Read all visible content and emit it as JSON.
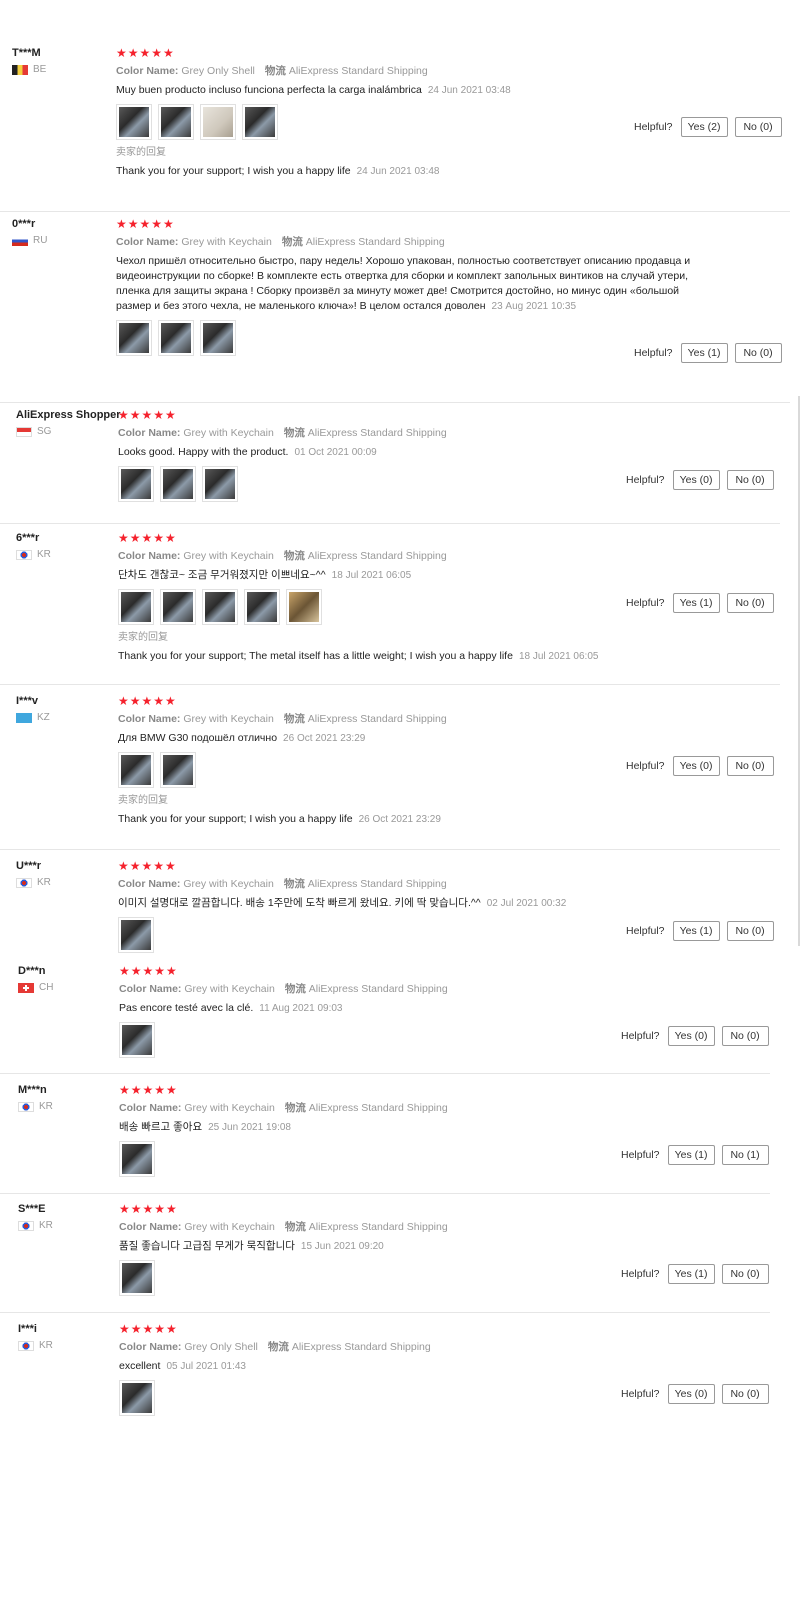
{
  "labels": {
    "color_name": "Color Name:",
    "logistics": "物流",
    "helpful": "Helpful?",
    "seller_reply": "卖家的回复"
  },
  "colors": {
    "star_red": "#f5222d",
    "meta_gray": "#999999",
    "button_border": "#999999"
  },
  "reviews": [
    {
      "user": "T***M",
      "country": "BE",
      "flag": "flag-belgium",
      "stars": "★★★★★",
      "color": "Grey Only Shell",
      "shipping": "AliExpress Standard Shipping",
      "text": "Muy buen producto incluso funciona perfecta la carga inalámbrica",
      "date": "24 Jun 2021 03:48",
      "photos": [
        "key-case-photo",
        "key-case-photo",
        "package-photo",
        "key-case-photo"
      ],
      "reply": "Thank you for your support; I wish you a happy life",
      "reply_date": "24 Jun 2021 03:48",
      "yes": "Yes (2)",
      "no": "No (0)"
    },
    {
      "user": "0***r",
      "country": "RU",
      "flag": "flag-russia",
      "stars": "★★★★★",
      "color": "Grey with Keychain",
      "shipping": "AliExpress Standard Shipping",
      "text": "Чехол пришёл относительно быстро, пару недель! Хорошо упакован, полностью соответствует описанию продавца и видеоинструкции по сборке! В комплекте есть отвертка для сборки и комплект запольных винтиков на случай утери, пленка для защиты экрана ! Сборку произвёл за минуту может две! Смотрится достойно, но минус один «большой размер и без этого чехла, не маленького ключа»! В целом остался доволен",
      "date": "23 Aug 2021 10:35",
      "photos": [
        "key-case-photo",
        "key-case-photo",
        "key-case-photo"
      ],
      "yes": "Yes (1)",
      "no": "No (0)"
    },
    {
      "user": "AliExpress Shopper",
      "country": "SG",
      "flag": "flag-singapore",
      "stars": "★★★★★",
      "color": "Grey with Keychain",
      "shipping": "AliExpress Standard Shipping",
      "text": "Looks good. Happy with the product.",
      "date": "01 Oct 2021 00:09",
      "photos": [
        "key-case-photo",
        "key-case-photo",
        "key-case-photo"
      ],
      "yes": "Yes (0)",
      "no": "No (0)"
    },
    {
      "user": "6***r",
      "country": "KR",
      "flag": "flag-korea",
      "stars": "★★★★★",
      "color": "Grey with Keychain",
      "shipping": "AliExpress Standard Shipping",
      "text": "단차도 갠찮코~ 조금 무거워졌지만 이쁘네요~^^",
      "date": "18 Jul 2021 06:05",
      "photos": [
        "key-case-photo",
        "key-case-photo",
        "key-case-photo",
        "key-case-photo",
        "parts-photo"
      ],
      "reply": "Thank you for your support; The metal itself has a little weight; I wish you a happy life",
      "reply_date": "18 Jul 2021 06:05",
      "yes": "Yes (1)",
      "no": "No (0)"
    },
    {
      "user": "I***v",
      "country": "KZ",
      "flag": "flag-kazakhstan",
      "stars": "★★★★★",
      "color": "Grey with Keychain",
      "shipping": "AliExpress Standard Shipping",
      "text": "Для BMW G30 подошёл отлично",
      "date": "26 Oct 2021 23:29",
      "photos": [
        "key-case-photo",
        "key-case-photo"
      ],
      "reply": "Thank you for your support; I wish you a happy life",
      "reply_date": "26 Oct 2021 23:29",
      "yes": "Yes (0)",
      "no": "No (0)"
    },
    {
      "user": "U***r",
      "country": "KR",
      "flag": "flag-korea",
      "stars": "★★★★★",
      "color": "Grey with Keychain",
      "shipping": "AliExpress Standard Shipping",
      "text": "이미지 설명대로 깔끔합니다. 배송 1주만에 도착 빠르게 왔네요. 키에 딱 맞습니다.^^",
      "date": "02 Jul 2021 00:32",
      "photos": [
        "key-case-photo"
      ],
      "yes": "Yes (1)",
      "no": "No (0)"
    },
    {
      "user": "D***n",
      "country": "CH",
      "flag": "flag-switzerland",
      "stars": "★★★★★",
      "color": "Grey with Keychain",
      "shipping": "AliExpress Standard Shipping",
      "text": "Pas encore testé avec la clé.",
      "date": "11 Aug 2021 09:03",
      "photos": [
        "key-case-photo"
      ],
      "yes": "Yes (0)",
      "no": "No (0)"
    },
    {
      "user": "M***n",
      "country": "KR",
      "flag": "flag-korea",
      "stars": "★★★★★",
      "color": "Grey with Keychain",
      "shipping": "AliExpress Standard Shipping",
      "text": "배송 빠르고 좋아요",
      "date": "25 Jun 2021 19:08",
      "photos": [
        "key-case-photo"
      ],
      "yes": "Yes (1)",
      "no": "No (1)"
    },
    {
      "user": "S***E",
      "country": "KR",
      "flag": "flag-korea",
      "stars": "★★★★★",
      "color": "Grey with Keychain",
      "shipping": "AliExpress Standard Shipping",
      "text": "품질 좋습니다 고급짐 무게가 묵직합니다",
      "date": "15 Jun 2021 09:20",
      "photos": [
        "key-case-photo"
      ],
      "yes": "Yes (1)",
      "no": "No (0)"
    },
    {
      "user": "I***i",
      "country": "KR",
      "flag": "flag-korea",
      "stars": "★★★★★",
      "color": "Grey Only Shell",
      "shipping": "AliExpress Standard Shipping",
      "text": "excellent",
      "date": "05 Jul 2021 01:43",
      "photos": [
        "key-case-photo"
      ],
      "yes": "Yes (0)",
      "no": "No (0)"
    }
  ]
}
